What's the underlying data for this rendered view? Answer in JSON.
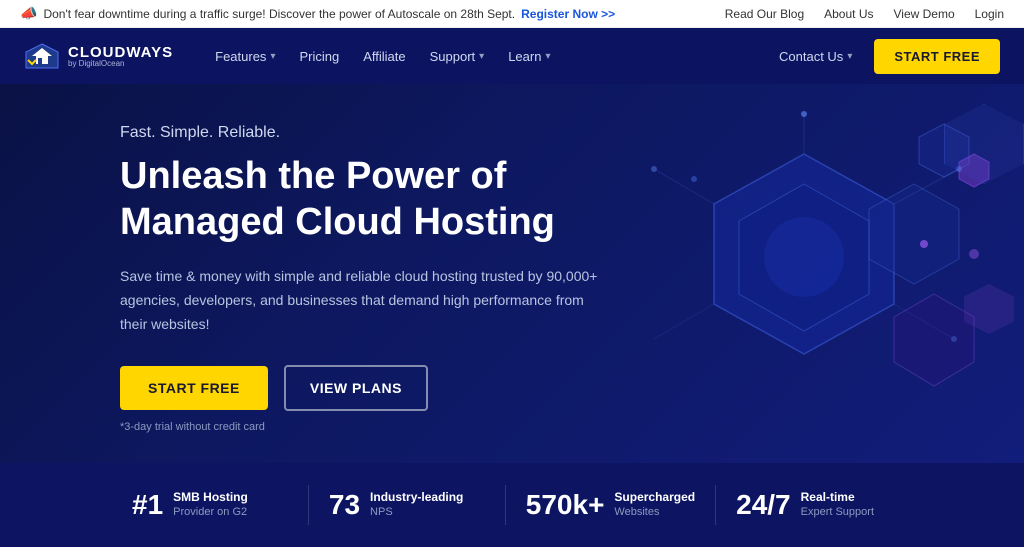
{
  "announcement": {
    "icon": "📣",
    "message": "Don't fear downtime during a traffic surge! Discover the power of Autoscale on 28th Sept.",
    "cta": "Register Now >>",
    "links": [
      "Read Our Blog",
      "About Us",
      "View Demo",
      "Login"
    ]
  },
  "navbar": {
    "logo": {
      "brand": "CLOUDWAYS",
      "sub": "by DigitalOcean"
    },
    "nav_items": [
      {
        "label": "Features",
        "has_dropdown": true
      },
      {
        "label": "Pricing",
        "has_dropdown": false
      },
      {
        "label": "Affiliate",
        "has_dropdown": false
      },
      {
        "label": "Support",
        "has_dropdown": true
      },
      {
        "label": "Learn",
        "has_dropdown": true
      }
    ],
    "contact_label": "Contact Us",
    "start_free_label": "START FREE"
  },
  "hero": {
    "tagline": "Fast. Simple. Reliable.",
    "title": "Unleash the Power of\nManaged Cloud Hosting",
    "description": "Save time & money with simple and reliable cloud hosting trusted by 90,000+ agencies, developers, and businesses that demand high performance from their websites!",
    "btn_start": "START FREE",
    "btn_plans": "VIEW PLANS",
    "trial_note": "*3-day trial without credit card"
  },
  "stats": [
    {
      "number": "#1",
      "label_main": "SMB Hosting",
      "label_sub": "Provider on G2"
    },
    {
      "number": "73",
      "label_main": "Industry-leading",
      "label_sub": "NPS"
    },
    {
      "number": "570k+",
      "label_main": "Supercharged",
      "label_sub": "Websites"
    },
    {
      "number": "24/7",
      "label_main": "Real-time",
      "label_sub": "Expert Support"
    }
  ],
  "colors": {
    "accent_yellow": "#ffd600",
    "bg_dark": "#0a1245",
    "bg_nav": "#0c1461",
    "bg_stats": "#0d1562"
  }
}
